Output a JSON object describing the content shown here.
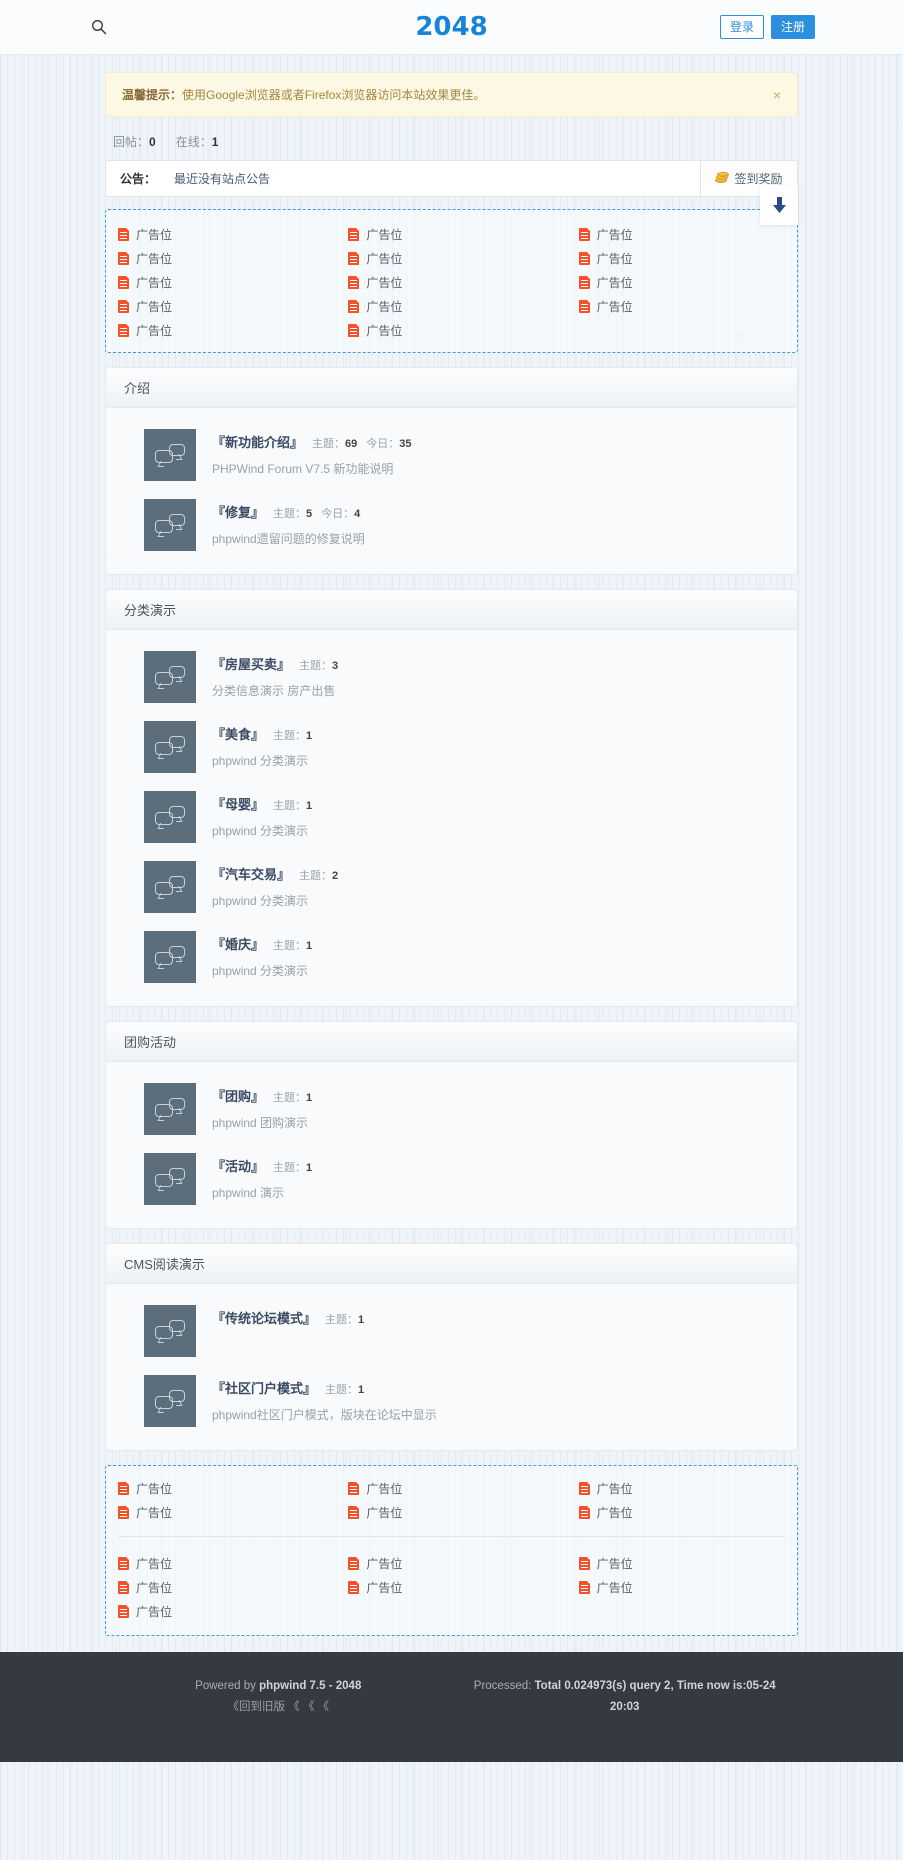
{
  "header": {
    "search_icon": "search-icon",
    "logo": "2048",
    "login_label": "登录",
    "register_label": "注册"
  },
  "notice": {
    "strong": "温馨提示：",
    "text": "使用Google浏览器或者Firefox浏览器访问本站效果更佳。",
    "close": "×"
  },
  "stats": {
    "reply_label": "回帖：",
    "reply_value": "0",
    "online_label": "在线：",
    "online_value": "1"
  },
  "announcement": {
    "label": "公告：",
    "text": "最近没有站点公告",
    "sign_label": "签到奖励",
    "sign_icon": "coin-icon"
  },
  "ads": {
    "label": "广告位",
    "icon": "document-icon",
    "top": {
      "col1": 5,
      "col2": 5,
      "col3": 4
    },
    "bottom_upper": {
      "col1": 2,
      "col2": 2,
      "col3": 2
    },
    "bottom_lower": {
      "col1": 3,
      "col2": 2,
      "col3": 2
    }
  },
  "side_float": {
    "icon": "arrow-down-icon",
    "color": "#2b4a80"
  },
  "panels": [
    {
      "title": "介绍",
      "forums": [
        {
          "name": "『新功能介绍』",
          "meta": [
            {
              "label": "主题：",
              "value": "69"
            },
            {
              "label": "今日：",
              "value": "35"
            }
          ],
          "desc": "PHPWind Forum V7.5 新功能说明"
        },
        {
          "name": "『修复』",
          "meta": [
            {
              "label": "主题：",
              "value": "5"
            },
            {
              "label": "今日：",
              "value": "4"
            }
          ],
          "desc": "phpwind遗留问题的修复说明"
        }
      ]
    },
    {
      "title": "分类演示",
      "forums": [
        {
          "name": "『房屋买卖』",
          "meta": [
            {
              "label": "主题：",
              "value": "3"
            }
          ],
          "desc": "分类信息演示 房产出售"
        },
        {
          "name": "『美食』",
          "meta": [
            {
              "label": "主题：",
              "value": "1"
            }
          ],
          "desc": "phpwind 分类演示"
        },
        {
          "name": "『母婴』",
          "meta": [
            {
              "label": "主题：",
              "value": "1"
            }
          ],
          "desc": "phpwind 分类演示"
        },
        {
          "name": "『汽车交易』",
          "meta": [
            {
              "label": "主题：",
              "value": "2"
            }
          ],
          "desc": "phpwind 分类演示"
        },
        {
          "name": "『婚庆』",
          "meta": [
            {
              "label": "主题：",
              "value": "1"
            }
          ],
          "desc": "phpwind 分类演示"
        }
      ]
    },
    {
      "title": "团购活动",
      "forums": [
        {
          "name": "『团购』",
          "meta": [
            {
              "label": "主题：",
              "value": "1"
            }
          ],
          "desc": "phpwind 团购演示"
        },
        {
          "name": "『活动』",
          "meta": [
            {
              "label": "主题：",
              "value": "1"
            }
          ],
          "desc": "phpwind 演示"
        }
      ]
    },
    {
      "title": "CMS阅读演示",
      "forums": [
        {
          "name": "『传统论坛模式』",
          "meta": [
            {
              "label": "主题：",
              "value": "1"
            }
          ],
          "desc": ""
        },
        {
          "name": "『社区门户模式』",
          "meta": [
            {
              "label": "主题：",
              "value": "1"
            }
          ],
          "desc": "phpwind社区门户模式，版块在论坛中显示"
        }
      ]
    }
  ],
  "footer": {
    "powered_prefix": "Powered by ",
    "powered_strong": "phpwind 7.5 - 2048",
    "old_version": "《回到旧版 《 《 《",
    "processed_prefix": "Processed: ",
    "processed_strong": "Total 0.024973(s) query 2, Time now is:05-24",
    "processed_time": "20:03"
  }
}
